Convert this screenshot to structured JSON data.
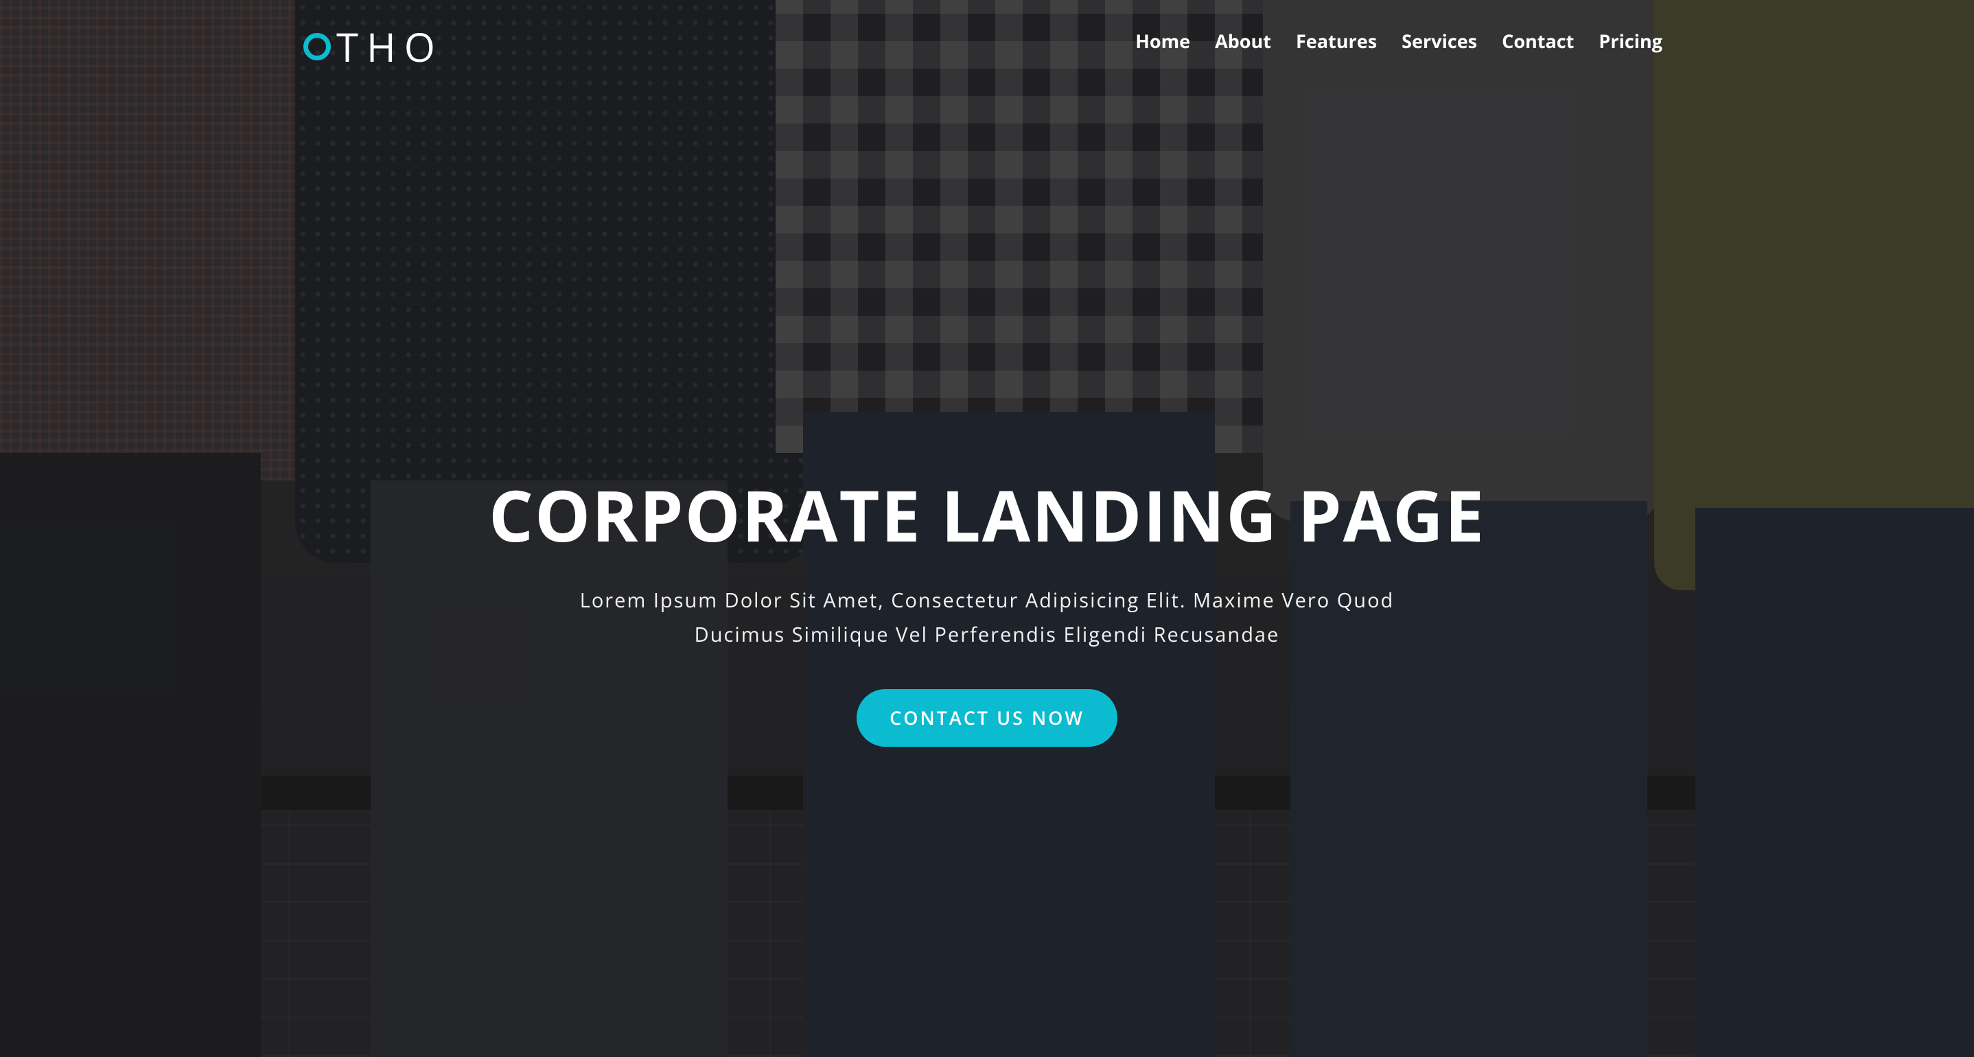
{
  "brand": {
    "logo_text": "THO"
  },
  "nav": {
    "items": [
      {
        "label": "Home"
      },
      {
        "label": "About"
      },
      {
        "label": "Features"
      },
      {
        "label": "Services"
      },
      {
        "label": "Contact"
      },
      {
        "label": "Pricing"
      }
    ]
  },
  "hero": {
    "title": "CORPORATE LANDING PAGE",
    "subtitle_line1": "Lorem Ipsum Dolor Sit Amet, Consectetur Adipisicing Elit. Maxime Vero Quod",
    "subtitle_line2": "Ducimus Similique Vel Perferendis Eligendi Recusandae",
    "cta_label": "CONTACT US NOW"
  },
  "colors": {
    "accent": "#0bbcd0",
    "text": "#ffffff",
    "overlay": "#141416"
  },
  "icons": {
    "logo_mark": "ring-logo-icon"
  }
}
